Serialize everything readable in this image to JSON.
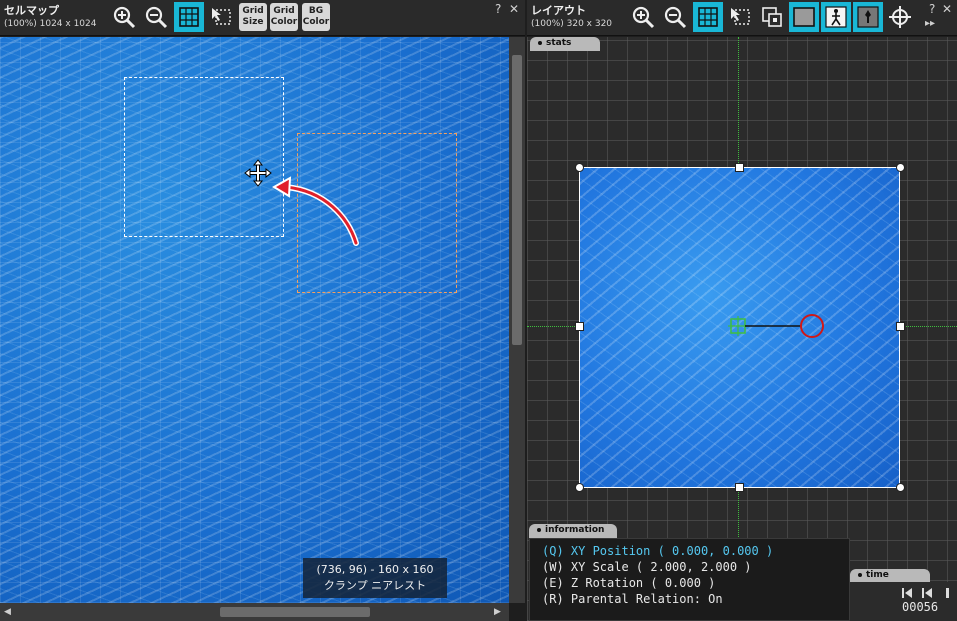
{
  "left_panel": {
    "title": "セルマップ",
    "subtitle": "(100%) 1024 x 1024",
    "help": "?",
    "close": "✕",
    "toolbar": {
      "grid_size": [
        "Grid",
        "Size"
      ],
      "grid_color": [
        "Grid",
        "Color"
      ],
      "bg_color": [
        "BG",
        "Color"
      ]
    },
    "tooltip": {
      "line1": "(736, 96) - 160 x 160",
      "line2": "クランプ ニアレスト"
    },
    "scroll": {
      "left": "◀",
      "right": "▶"
    }
  },
  "right_panel": {
    "title": "レイアウト",
    "subtitle": "(100%) 320 x 320",
    "help": "?",
    "close": "✕",
    "more": "▸▸",
    "stats_tab": "stats",
    "info_tab": "information",
    "time_tab": "time",
    "info_lines": [
      "(Q) XY Position ( 0.000, 0.000 )",
      "(W) XY Scale ( 2.000, 2.000 )",
      "(E) Z Rotation ( 0.000 )",
      "(R) Parental Relation: On"
    ],
    "time_value": "00056"
  },
  "colors": {
    "accent": "#19b7d6",
    "water": "#1a6fd0",
    "selection": "#f3a060",
    "arrow": "#e0202a"
  },
  "icons": [
    "zoom-in-icon",
    "zoom-out-icon",
    "grid-icon",
    "select-cursor-icon",
    "layer-icon",
    "frame-icon",
    "person-icon",
    "marker-icon",
    "crosshair-icon"
  ]
}
